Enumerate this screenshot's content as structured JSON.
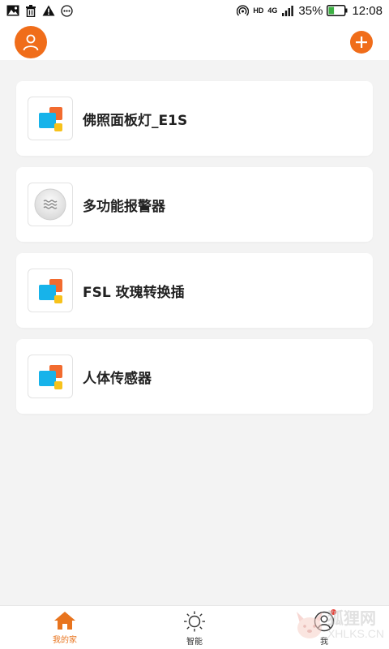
{
  "statusbar": {
    "network_hd": "HD",
    "network_4g": "4G",
    "battery_percent": "35%",
    "battery_level": 0.35,
    "time": "12:08"
  },
  "header": {
    "avatar_icon": "user-icon",
    "add_icon": "plus-icon"
  },
  "devices": [
    {
      "name": "佛照面板灯_E1S",
      "icon": "device-generic-icon"
    },
    {
      "name": "多功能报警器",
      "icon": "alarm-wave-icon"
    },
    {
      "name": "FSL 玫瑰转换插",
      "icon": "device-generic-icon"
    },
    {
      "name": "人体传感器",
      "icon": "device-generic-icon"
    }
  ],
  "bottomnav": {
    "items": [
      {
        "label": "我的家",
        "icon": "home-icon",
        "active": true
      },
      {
        "label": "智能",
        "icon": "sun-icon",
        "active": false
      },
      {
        "label": "我",
        "icon": "profile-icon",
        "active": false,
        "badge": true
      }
    ]
  },
  "watermark": {
    "cn": "狐狸网",
    "en": "XHLKS.CN"
  },
  "colors": {
    "accent": "#f06d1a",
    "background": "#f3f3f3",
    "card": "#ffffff"
  }
}
